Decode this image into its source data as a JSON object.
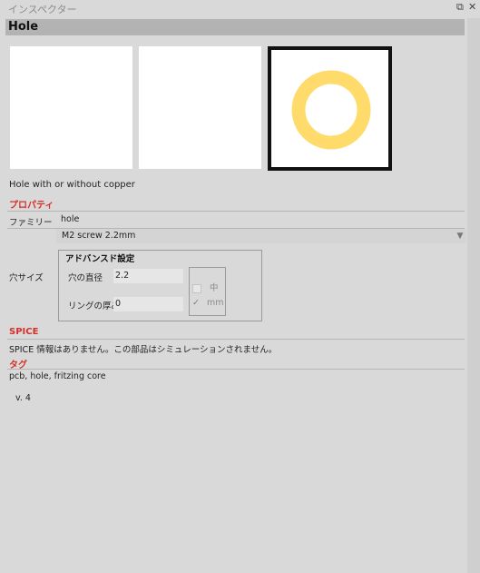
{
  "window": {
    "title": "インスペクター",
    "float_glyph": "⧉",
    "close_glyph": "✕"
  },
  "header": {
    "title": "Hole"
  },
  "previews": [
    {
      "kind": "breadboard",
      "selected": false
    },
    {
      "kind": "schematic",
      "selected": false
    },
    {
      "kind": "pcb",
      "selected": true,
      "ring_color": "#ffdb6b"
    }
  ],
  "description": "Hole with or without copper",
  "properties": {
    "section_title": "プロパティ",
    "family_label": "ファミリー",
    "family_value": "hole",
    "variant_value": "M2 screw 2.2mm",
    "hole_size_label": "穴サイズ",
    "advanced": {
      "title": "アドバンスド設定",
      "diameter_label": "穴の直径",
      "diameter_value": "2.2",
      "ring_label": "リングの厚み",
      "ring_value": "0",
      "unit_options": [
        {
          "label": "中",
          "checked": false
        },
        {
          "label": "mm",
          "checked": true
        }
      ]
    }
  },
  "spice": {
    "section_title": "SPICE",
    "text": "SPICE 情報はありません。この部品はシミュレーションされません。"
  },
  "tags": {
    "section_title": "タグ",
    "text": "pcb, hole, fritzing core"
  },
  "version": "v. 4",
  "colors": {
    "accent_red": "#d6302a",
    "header_bar": "#b3b3b3",
    "background": "#d9d9d9"
  }
}
